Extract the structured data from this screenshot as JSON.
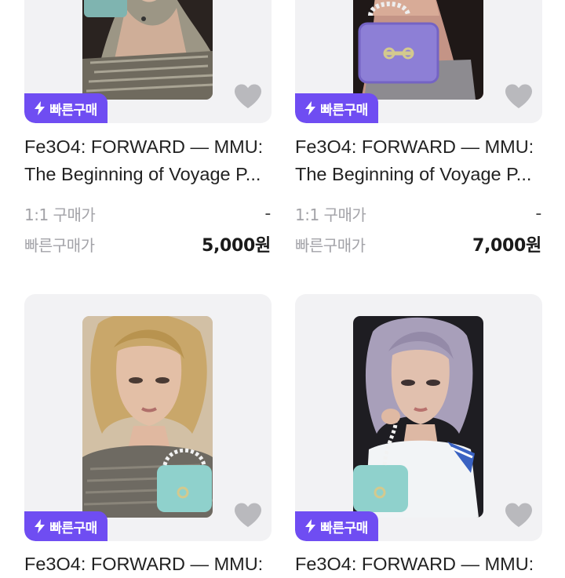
{
  "colors": {
    "accent": "#6f4df2",
    "card_bg": "#f2f2f4",
    "heart": "#b9b9bd",
    "muted_text": "#a3a3a8"
  },
  "products": [
    {
      "badge_icon": "lightning-icon",
      "badge_label": "빠른구매",
      "title_line1": "Fe3O4: FORWARD — MMU:",
      "title_line2": "The Beginning of Voyage P...",
      "price_1to1_label": "1:1 구매가",
      "price_1to1_value": "-",
      "quick_price_label": "빠른구매가",
      "quick_price_value": "5,000원",
      "favorite_icon": "heart-icon"
    },
    {
      "badge_icon": "lightning-icon",
      "badge_label": "빠른구매",
      "title_line1": "Fe3O4: FORWARD — MMU:",
      "title_line2": "The Beginning of Voyage P...",
      "price_1to1_label": "1:1 구매가",
      "price_1to1_value": "-",
      "quick_price_label": "빠른구매가",
      "quick_price_value": "7,000원",
      "favorite_icon": "heart-icon"
    },
    {
      "badge_icon": "lightning-icon",
      "badge_label": "빠른구매",
      "title_line1": "Fe3O4: FORWARD — MMU:",
      "favorite_icon": "heart-icon"
    },
    {
      "badge_icon": "lightning-icon",
      "badge_label": "빠른구매",
      "title_line1": "Fe3O4: FORWARD — MMU:",
      "favorite_icon": "heart-icon"
    }
  ]
}
